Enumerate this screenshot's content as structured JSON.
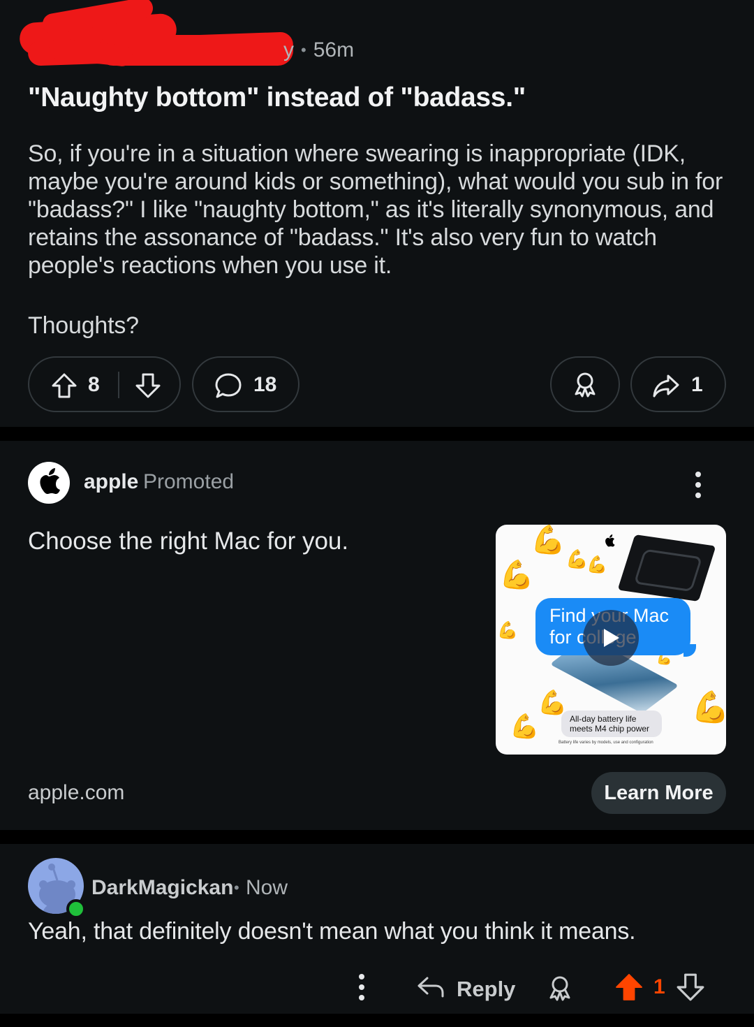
{
  "post": {
    "meta_visible_fragment": "y",
    "timestamp": "56m",
    "title": "\"Naughty bottom\" instead of \"badass.\"",
    "body_paragraph_1": "So, if you're in a situation where swearing is inappropriate (IDK, maybe you're around kids or something), what would you sub in for \"badass?\" I like \"naughty bottom,\" as it's literally synonymous, and retains the assonance of \"badass.\" It's also very fun to watch people's reactions when you use it.",
    "body_paragraph_2": "Thoughts?",
    "upvotes": "8",
    "comment_count": "18",
    "share_count": "1",
    "redaction_color": "#ee1818"
  },
  "ad": {
    "advertiser": "apple",
    "promoted_label": "Promoted",
    "headline": "Choose the right Mac for you.",
    "media": {
      "bubble_text_line1": "Find your Mac",
      "bubble_text_line2": "for college",
      "caption_line1": "All-day battery life",
      "caption_line2": "meets M4 chip power",
      "fineprint": "Battery life varies by models, use and configuration",
      "emoji": "flexed-biceps",
      "bubble_color": "#1a8bf6"
    },
    "domain": "apple.com",
    "cta": "Learn More"
  },
  "comment": {
    "author": "DarkMagickan",
    "timestamp": "Now",
    "body": "Yeah, that definitely doesn't mean what you think it means.",
    "reply_label": "Reply",
    "score": "1",
    "upvote_active_color": "#ff4500"
  }
}
